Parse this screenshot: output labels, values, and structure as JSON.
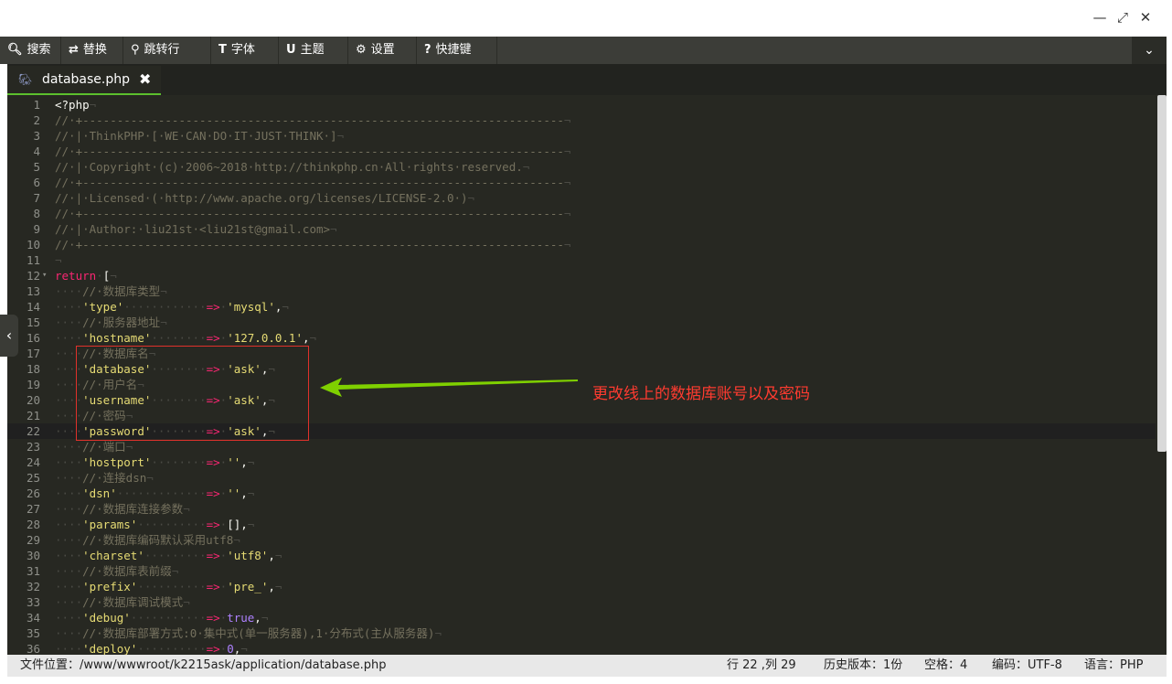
{
  "window": {
    "minimize_glyph": "—",
    "maximize_glyph": "⤢",
    "close_glyph": "✕"
  },
  "toolbar": {
    "items": [
      {
        "icon": "search-icon",
        "glyph": "🔍︎",
        "label": "搜索"
      },
      {
        "icon": "replace-icon",
        "glyph": "⇄",
        "label": "替换"
      },
      {
        "icon": "pin-icon",
        "glyph": "⚲",
        "label": "跳转行"
      },
      {
        "icon": "font-icon",
        "glyph": "T",
        "label": "字体"
      },
      {
        "icon": "theme-icon",
        "glyph": "U",
        "label": "主题"
      },
      {
        "icon": "gear-icon",
        "glyph": "⚙",
        "label": "设置"
      },
      {
        "icon": "help-icon",
        "glyph": "?",
        "label": "快捷键"
      }
    ],
    "expand_glyph": "⌄"
  },
  "tab": {
    "filename": "database.php",
    "close_glyph": "✖"
  },
  "editor": {
    "active_line": 22,
    "lines": [
      "<?php¬",
      "//·+----------------------------------------------------------------------¬",
      "//·|·ThinkPHP·[·WE·CAN·DO·IT·JUST·THINK·]¬",
      "//·+----------------------------------------------------------------------¬",
      "//·|·Copyright·(c)·2006~2018·http://thinkphp.cn·All·rights·reserved.¬",
      "//·+----------------------------------------------------------------------¬",
      "//·|·Licensed·(·http://www.apache.org/licenses/LICENSE-2.0·)¬",
      "//·+----------------------------------------------------------------------¬",
      "//·|·Author:·liu21st·<liu21st@gmail.com>¬",
      "//·+----------------------------------------------------------------------¬",
      "¬",
      "return·[¬",
      "····//·数据库类型¬",
      "····'type'············=>·'mysql',¬",
      "····//·服务器地址¬",
      "····'hostname'········=>·'127.0.0.1',¬",
      "····//·数据库名¬",
      "····'database'········=>·'ask',¬",
      "····//·用户名¬",
      "····'username'········=>·'ask',¬",
      "····//·密码¬",
      "····'password'········=>·'ask',¬",
      "····//·端口¬",
      "····'hostport'········=>·'',¬",
      "····//·连接dsn¬",
      "····'dsn'·············=>·'',¬",
      "····//·数据库连接参数¬",
      "····'params'··········=>·[],¬",
      "····//·数据库编码默认采用utf8¬",
      "····'charset'·········=>·'utf8',¬",
      "····//·数据库表前缀¬",
      "····'prefix'··········=>·'pre_',¬",
      "····//·数据库调试模式¬",
      "····'debug'···········=>·true,¬",
      "····//·数据库部署方式:0·集中式(单一服务器),1·分布式(主从服务器)¬",
      "····'deploy'··········=>·0,¬"
    ]
  },
  "annotation": {
    "text": "更改线上的数据库账号以及密码",
    "color": "#ff3b30",
    "arrow_color": "#7fd000"
  },
  "statusbar": {
    "path_label": "文件位置：/www/wwwroot/k2215ask/application/database.php",
    "cursor": "行 22 ,列 29",
    "history": "历史版本：1份",
    "indent": "空格：4",
    "encoding": "编码：UTF-8",
    "language": "语言：PHP"
  },
  "side_handle_glyph": "‹"
}
